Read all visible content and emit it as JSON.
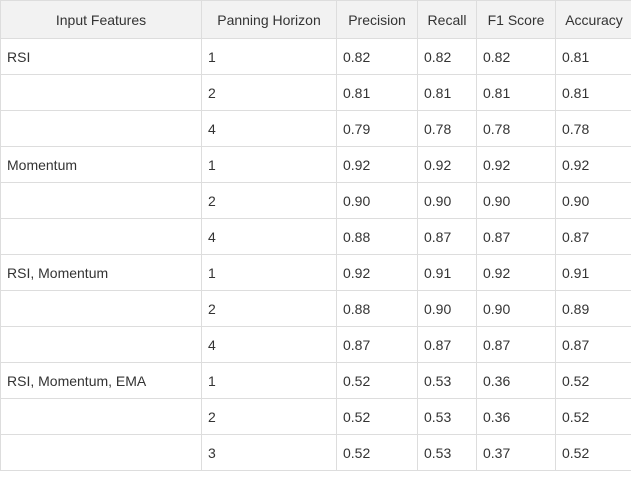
{
  "table": {
    "headers": [
      "Input Features",
      "Panning Horizon",
      "Precision",
      "Recall",
      "F1 Score",
      "Accuracy"
    ],
    "rows": [
      {
        "features": "RSI",
        "horizon": "1",
        "precision": "0.82",
        "recall": "0.82",
        "f1": "0.82",
        "accuracy": "0.81"
      },
      {
        "features": "",
        "horizon": "2",
        "precision": "0.81",
        "recall": "0.81",
        "f1": "0.81",
        "accuracy": "0.81"
      },
      {
        "features": "",
        "horizon": "4",
        "precision": "0.79",
        "recall": "0.78",
        "f1": "0.78",
        "accuracy": "0.78"
      },
      {
        "features": "Momentum",
        "horizon": "1",
        "precision": "0.92",
        "recall": "0.92",
        "f1": "0.92",
        "accuracy": "0.92"
      },
      {
        "features": "",
        "horizon": "2",
        "precision": "0.90",
        "recall": "0.90",
        "f1": "0.90",
        "accuracy": "0.90"
      },
      {
        "features": "",
        "horizon": "4",
        "precision": "0.88",
        "recall": "0.87",
        "f1": "0.87",
        "accuracy": "0.87"
      },
      {
        "features": "RSI, Momentum",
        "horizon": "1",
        "precision": "0.92",
        "recall": "0.91",
        "f1": "0.92",
        "accuracy": "0.91"
      },
      {
        "features": "",
        "horizon": "2",
        "precision": "0.88",
        "recall": "0.90",
        "f1": "0.90",
        "accuracy": "0.89"
      },
      {
        "features": "",
        "horizon": "4",
        "precision": "0.87",
        "recall": "0.87",
        "f1": "0.87",
        "accuracy": "0.87"
      },
      {
        "features": "RSI, Momentum, EMA",
        "horizon": "1",
        "precision": "0.52",
        "recall": "0.53",
        "f1": "0.36",
        "accuracy": "0.52"
      },
      {
        "features": "",
        "horizon": "2",
        "precision": "0.52",
        "recall": "0.53",
        "f1": "0.36",
        "accuracy": "0.52"
      },
      {
        "features": "",
        "horizon": "3",
        "precision": "0.52",
        "recall": "0.53",
        "f1": "0.37",
        "accuracy": "0.52"
      }
    ]
  },
  "colors": {
    "header_bg": "#f2f2f2",
    "border": "#dddddd",
    "text": "#333333"
  }
}
